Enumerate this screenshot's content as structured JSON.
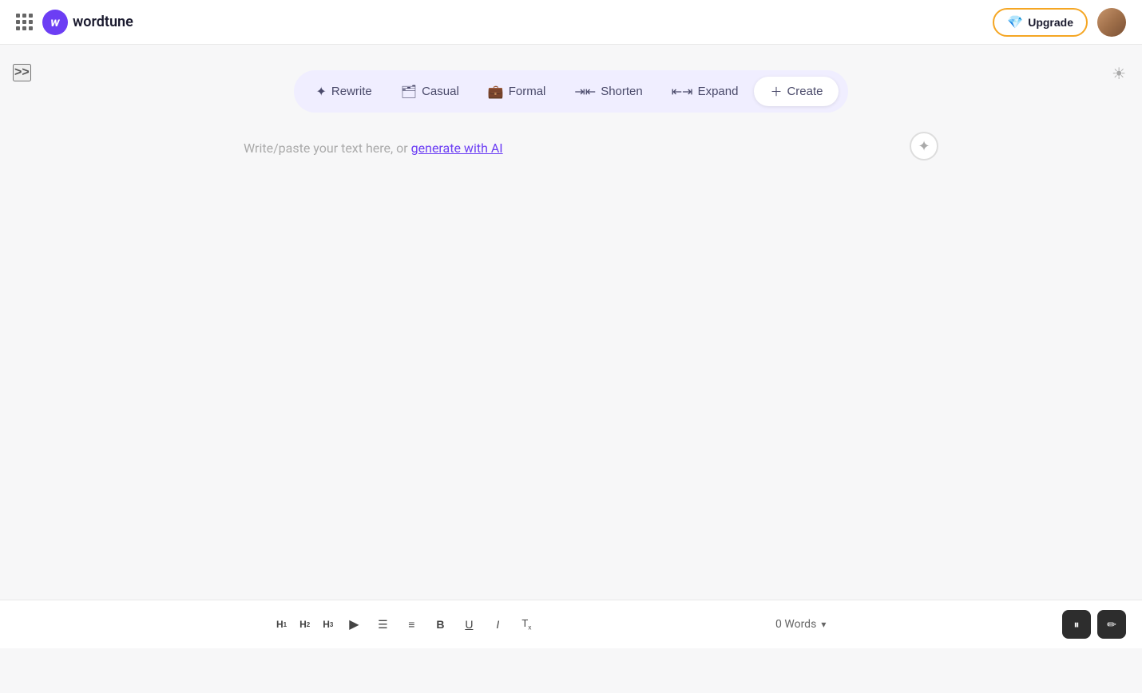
{
  "app": {
    "name": "wordtune",
    "logo_letter": "w"
  },
  "header": {
    "upgrade_label": "Upgrade",
    "logo_text": "wordtune"
  },
  "sidebar": {
    "toggle_label": ">>"
  },
  "toolbar": {
    "rewrite_label": "Rewrite",
    "casual_label": "Casual",
    "formal_label": "Formal",
    "shorten_label": "Shorten",
    "expand_label": "Expand",
    "create_label": "Create"
  },
  "editor": {
    "placeholder_text": "Write/paste your text here, or ",
    "placeholder_link": "generate with AI"
  },
  "bottom_toolbar": {
    "h1_label": "H",
    "h1_sub": "1",
    "h2_label": "H",
    "h2_sub": "2",
    "h3_label": "H",
    "h3_sub": "3",
    "word_count": "0 Words"
  }
}
